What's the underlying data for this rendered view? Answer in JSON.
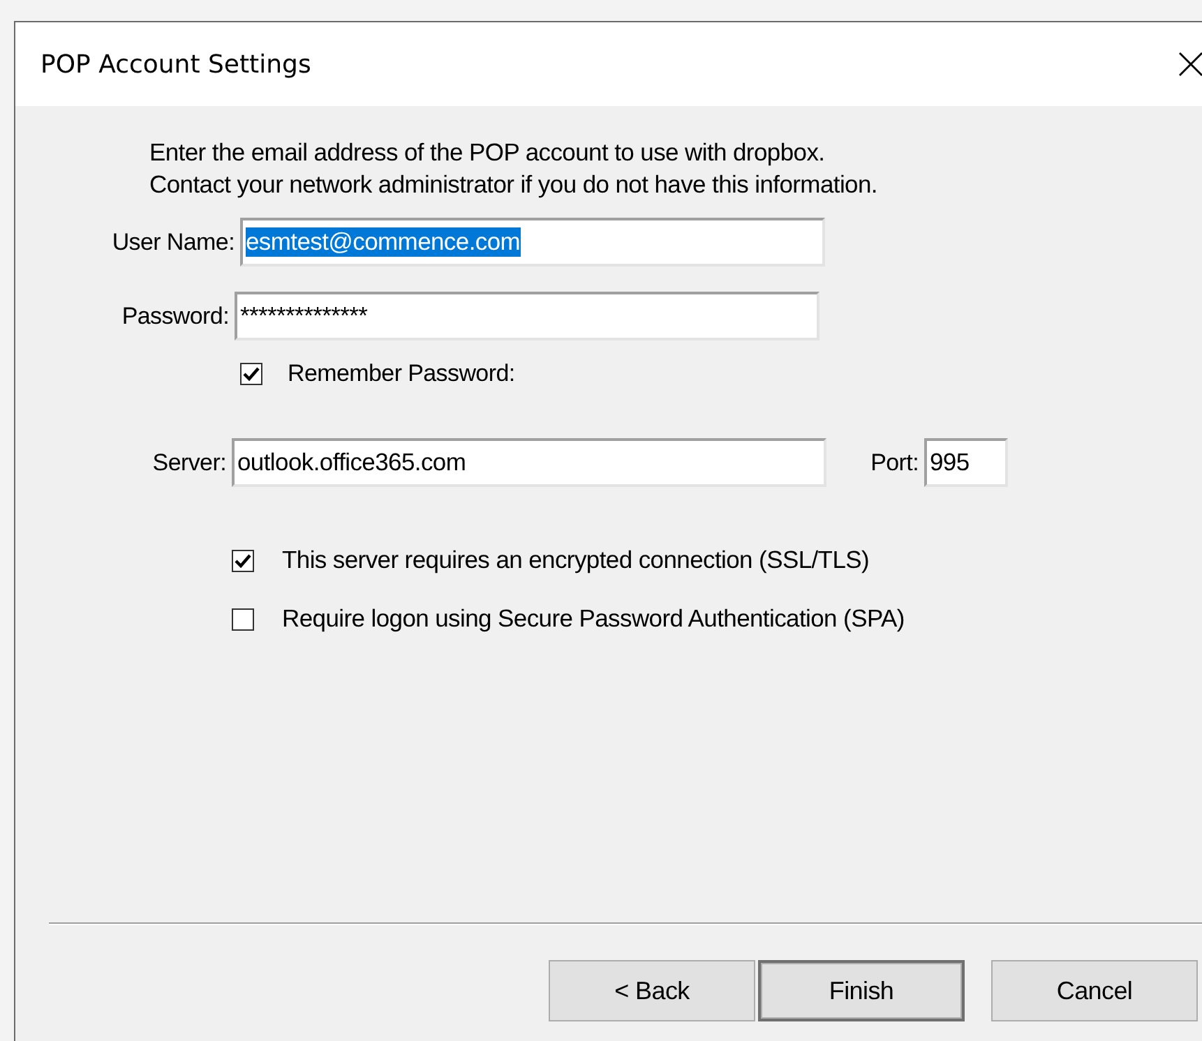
{
  "window": {
    "title": "POP Account Settings"
  },
  "intro": [
    "Enter the email address of the POP account to use with dropbox.",
    "Contact your network administrator if you do not have this information."
  ],
  "user_name": {
    "label": "User Name:",
    "value": "esmtest@commence.com",
    "text_selected": true
  },
  "password": {
    "label": "Password:",
    "value": "**************"
  },
  "remember": {
    "label": "Remember Password:",
    "checked": true
  },
  "server": {
    "label": "Server:",
    "value": "outlook.office365.com"
  },
  "port": {
    "label": "Port:",
    "value": "995"
  },
  "options": [
    {
      "label": "This server requires an encrypted connection (SSL/TLS)",
      "checked": true
    },
    {
      "label": "Require logon using Secure Password Authentication (SPA)",
      "checked": false
    }
  ],
  "buttons": [
    {
      "label": "< Back",
      "default": false
    },
    {
      "label": "Finish",
      "default": true
    },
    {
      "label": "Cancel",
      "default": false
    }
  ]
}
